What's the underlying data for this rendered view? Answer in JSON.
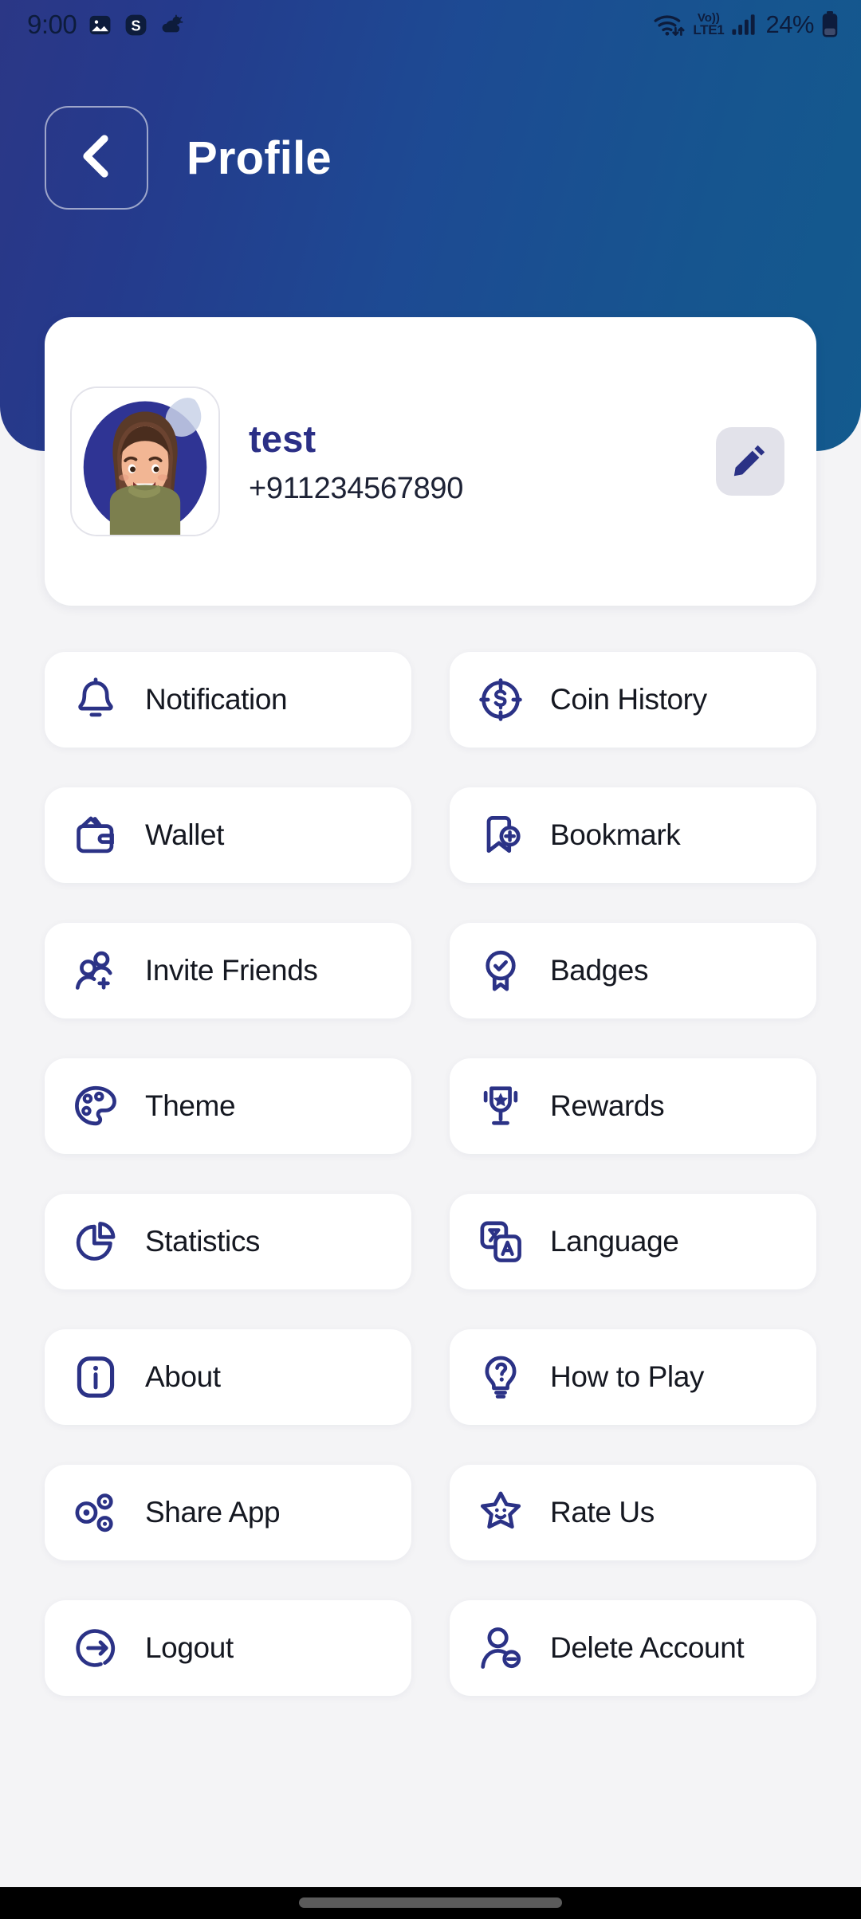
{
  "status_bar": {
    "clock": "9:00",
    "left_icons": [
      "photos-icon",
      "skype-icon",
      "weather-icon"
    ],
    "wifi_icon": "wifi-icon",
    "volte_top": "Vo))",
    "volte_bottom": "LTE1",
    "signal_icon": "signal-bars-icon",
    "battery_percent": "24%",
    "battery_icon": "battery-icon"
  },
  "appbar": {
    "back_icon": "chevron-left-icon",
    "title": "Profile"
  },
  "profile": {
    "avatar_icon": "user-avatar",
    "avatar_edit_badge_icon": "pencil-badge-icon",
    "name": "test",
    "phone": "+911234567890",
    "edit_button_icon": "pencil-icon"
  },
  "menu": {
    "items": [
      {
        "label": "Notification",
        "icon": "bell-icon"
      },
      {
        "label": "Coin History",
        "icon": "coin-target-icon"
      },
      {
        "label": "Wallet",
        "icon": "wallet-icon"
      },
      {
        "label": "Bookmark",
        "icon": "bookmark-plus-icon"
      },
      {
        "label": "Invite Friends",
        "icon": "users-plus-icon"
      },
      {
        "label": "Badges",
        "icon": "badge-check-icon"
      },
      {
        "label": "Theme",
        "icon": "palette-icon"
      },
      {
        "label": "Rewards",
        "icon": "trophy-star-icon"
      },
      {
        "label": "Statistics",
        "icon": "pie-chart-icon"
      },
      {
        "label": "Language",
        "icon": "translate-icon"
      },
      {
        "label": "About",
        "icon": "info-icon"
      },
      {
        "label": "How to Play",
        "icon": "lightbulb-question-icon"
      },
      {
        "label": "Share App",
        "icon": "share-nodes-icon"
      },
      {
        "label": "Rate Us",
        "icon": "star-smile-icon"
      },
      {
        "label": "Logout",
        "icon": "logout-icon"
      },
      {
        "label": "Delete Account",
        "icon": "user-minus-icon"
      }
    ]
  },
  "colors": {
    "header_gradient_start": "#2b3786",
    "header_gradient_end": "#135a8e",
    "icon_navy": "#2b3286",
    "name_navy": "#2b2f86",
    "page_bg": "#f4f4f6",
    "card_bg": "#ffffff",
    "edit_btn_bg": "#e2e2ea"
  },
  "navbar": {
    "home_indicator": "home-indicator-pill"
  }
}
